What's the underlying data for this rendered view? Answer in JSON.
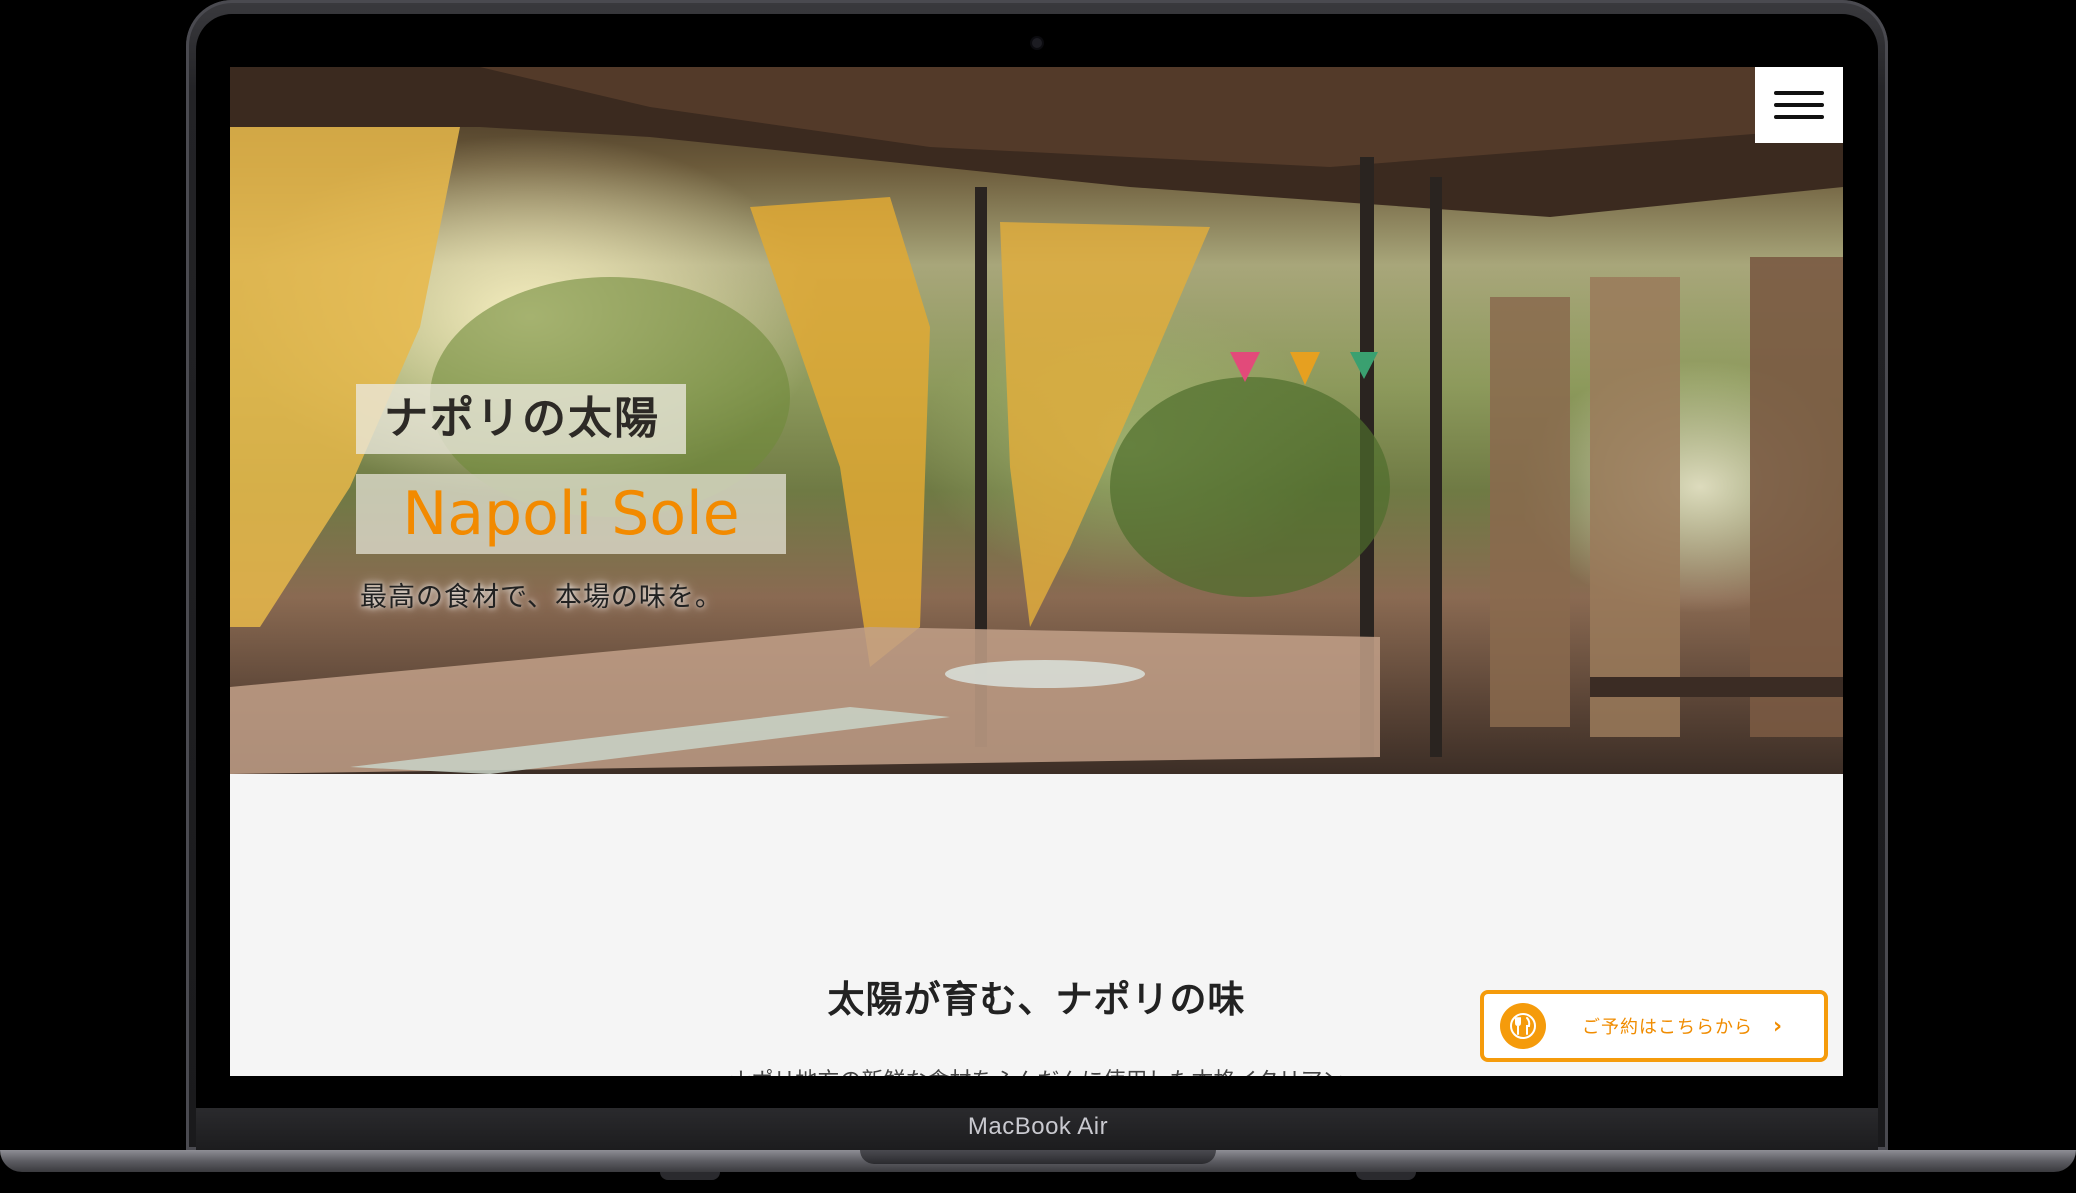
{
  "device": {
    "label": "MacBook Air"
  },
  "header": {
    "menu_icon": "hamburger-menu-icon"
  },
  "hero": {
    "title_jp": "ナポリの太陽",
    "title_en": "Napoli Sole",
    "tagline": "最高の食材で、本場の味を。"
  },
  "main": {
    "section_title": "太陽が育む、ナポリの味",
    "section_body": "ナポリ地方の新鮮な食材をふんだんに使用した本格イタリアン"
  },
  "reserve": {
    "icon": "fork-knife-icon",
    "label": "ご予約はこちらから",
    "chevron": "›"
  },
  "colors": {
    "accent": "#f59b0b",
    "brand_text": "#f28a00"
  }
}
